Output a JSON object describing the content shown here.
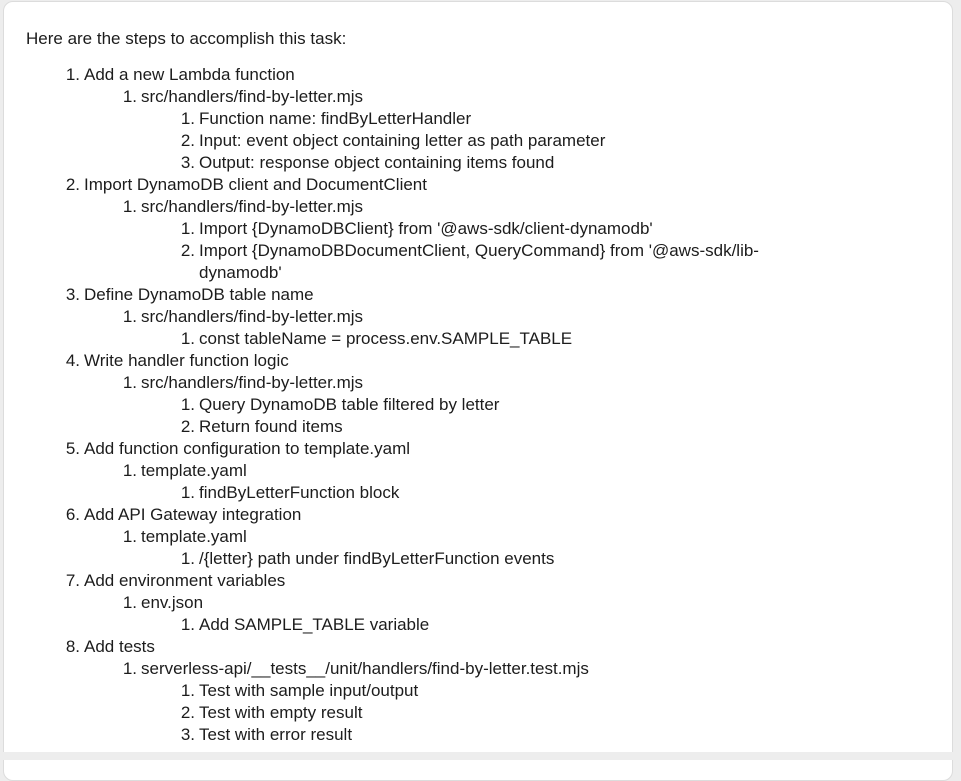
{
  "intro": "Here are the steps to accomplish this task:",
  "steps": [
    {
      "level": 1,
      "num": "1.",
      "text": "Add a new Lambda function"
    },
    {
      "level": 2,
      "num": "1.",
      "text": "src/handlers/find-by-letter.mjs"
    },
    {
      "level": 3,
      "num": "1.",
      "text": "Function name: findByLetterHandler"
    },
    {
      "level": 3,
      "num": "2.",
      "text": "Input: event object containing letter as path parameter"
    },
    {
      "level": 3,
      "num": "3.",
      "text": "Output: response object containing items found"
    },
    {
      "level": 1,
      "num": "2.",
      "text": "Import DynamoDB client and DocumentClient"
    },
    {
      "level": 2,
      "num": "1.",
      "text": "src/handlers/find-by-letter.mjs"
    },
    {
      "level": 3,
      "num": "1.",
      "text": "Import {DynamoDBClient} from '@aws-sdk/client-dynamodb'"
    },
    {
      "level": 3,
      "num": "2.",
      "text": "Import {DynamoDBDocumentClient, QueryCommand} from '@aws-sdk/lib-",
      "cont": "dynamodb'"
    },
    {
      "level": 1,
      "num": "3.",
      "text": "Define DynamoDB table name"
    },
    {
      "level": 2,
      "num": "1.",
      "text": "src/handlers/find-by-letter.mjs"
    },
    {
      "level": 3,
      "num": "1.",
      "text": "const tableName = process.env.SAMPLE_TABLE"
    },
    {
      "level": 1,
      "num": "4.",
      "text": "Write handler function logic"
    },
    {
      "level": 2,
      "num": "1.",
      "text": "src/handlers/find-by-letter.mjs"
    },
    {
      "level": 3,
      "num": "1.",
      "text": "Query DynamoDB table filtered by letter"
    },
    {
      "level": 3,
      "num": "2.",
      "text": "Return found items"
    },
    {
      "level": 1,
      "num": "5.",
      "text": "Add function configuration to template.yaml"
    },
    {
      "level": 2,
      "num": "1.",
      "text": "template.yaml"
    },
    {
      "level": 3,
      "num": "1.",
      "text": "findByLetterFunction block"
    },
    {
      "level": 1,
      "num": "6.",
      "text": "Add API Gateway integration"
    },
    {
      "level": 2,
      "num": "1.",
      "text": "template.yaml"
    },
    {
      "level": 3,
      "num": "1.",
      "text": "/{letter} path under findByLetterFunction events"
    },
    {
      "level": 1,
      "num": "7.",
      "text": "Add environment variables"
    },
    {
      "level": 2,
      "num": "1.",
      "text": "env.json"
    },
    {
      "level": 3,
      "num": "1.",
      "text": "Add SAMPLE_TABLE variable"
    },
    {
      "level": 1,
      "num": "8.",
      "text": "Add tests"
    },
    {
      "level": 2,
      "num": "1.",
      "text": "serverless-api/__tests__/unit/handlers/find-by-letter.test.mjs"
    },
    {
      "level": 3,
      "num": "1.",
      "text": "Test with sample input/output"
    },
    {
      "level": 3,
      "num": "2.",
      "text": "Test with empty result"
    },
    {
      "level": 3,
      "num": "3.",
      "text": "Test with error result"
    }
  ]
}
